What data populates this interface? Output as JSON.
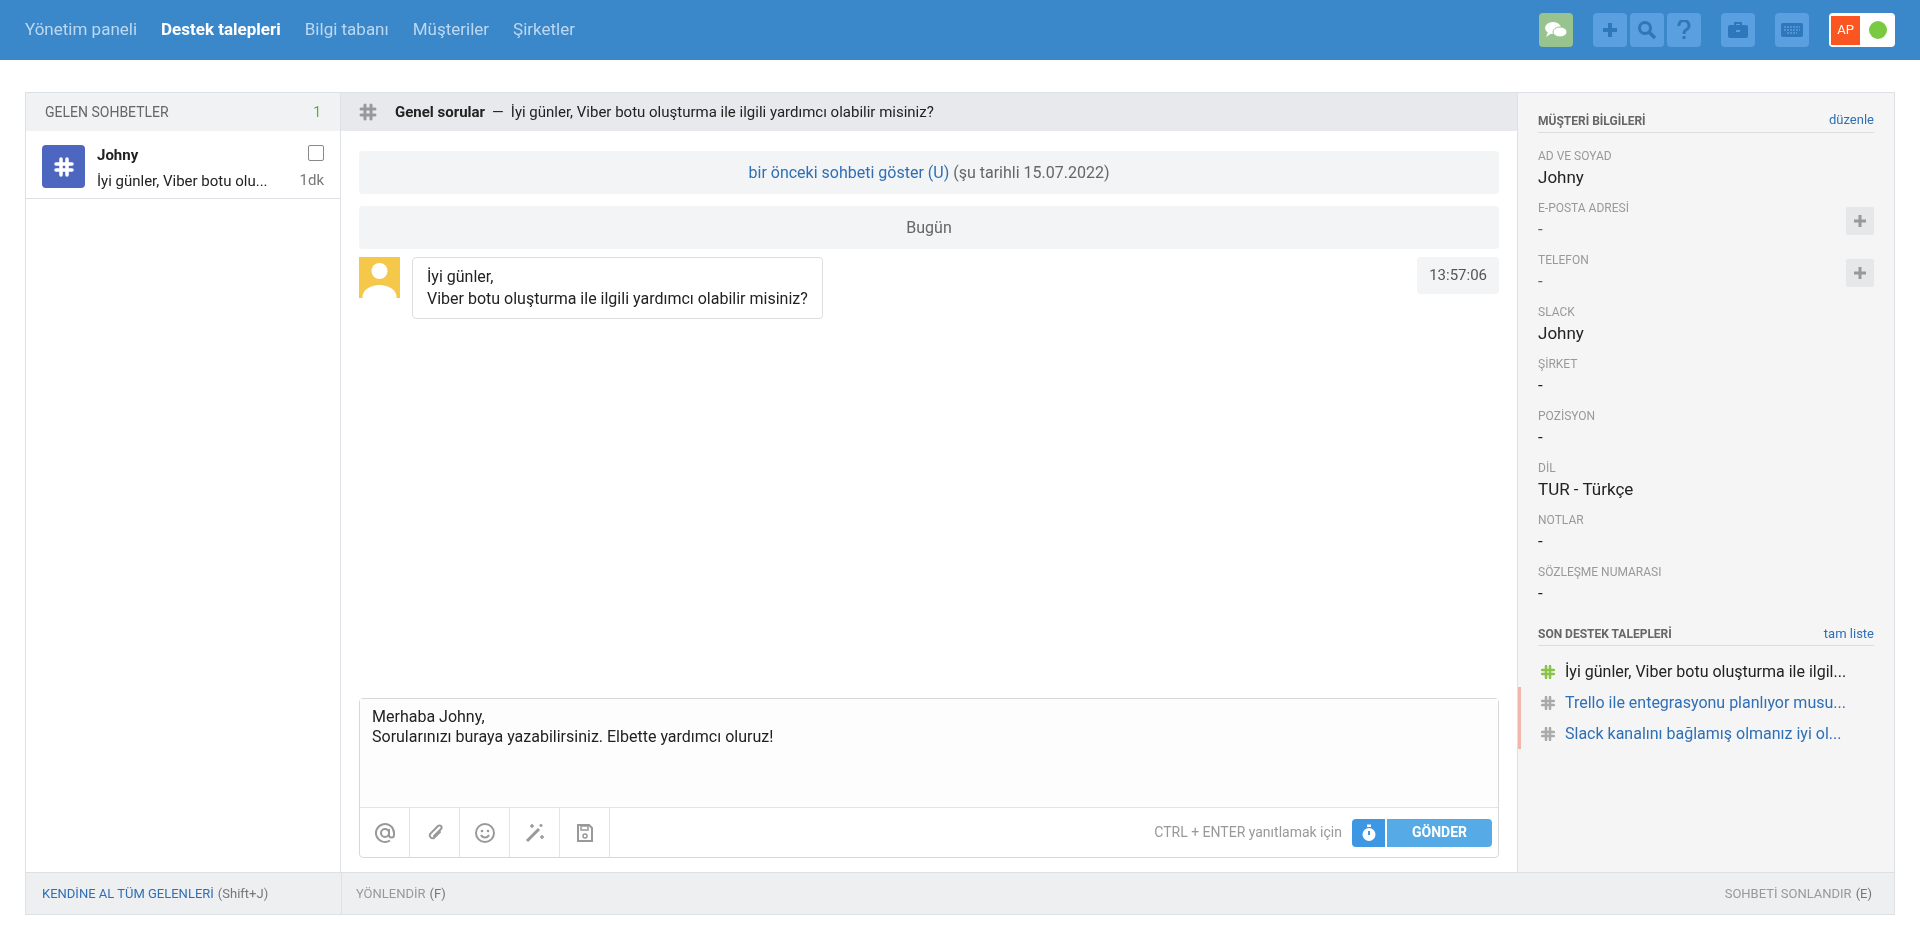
{
  "nav": [
    {
      "label": "Yönetim paneli",
      "selected": false
    },
    {
      "label": "Destek talepleri",
      "selected": true
    },
    {
      "label": "Bilgi tabanı",
      "selected": false
    },
    {
      "label": "Müşteriler",
      "selected": false
    },
    {
      "label": "Şirketler",
      "selected": false
    }
  ],
  "user": {
    "initials": "AP",
    "online": true
  },
  "incoming": {
    "title": "GELEN SOHBETLER",
    "count": "1",
    "chats": [
      {
        "name": "Johny",
        "preview": "İyi günler, Viber botu olu...",
        "time": "1dk",
        "checked": false
      }
    ]
  },
  "chat": {
    "channel": "Genel sorular",
    "separator": "—",
    "subject": "İyi günler, Viber botu oluşturma ile ilgili yardımcı olabilir misiniz?",
    "previous_link": "bir önceki sohbeti göster (U)",
    "previous_date": "(şu tarihli 15.07.2022)",
    "day": "Bugün",
    "messages": [
      {
        "lines": [
          "İyi günler,",
          "Viber botu oluşturma ile ilgili yardımcı olabilir misiniz?"
        ],
        "time": "13:57:06"
      }
    ],
    "draft": "Merhaba Johny,\nSorularınızı buraya yazabilirsiniz. Elbette yardımcı oluruz!",
    "hint": "CTRL + ENTER yanıtlamak için",
    "send": "GÖNDER"
  },
  "customer": {
    "title": "MÜŞTERİ BİLGİLERİ",
    "edit": "düzenle",
    "fields": [
      {
        "label": "AD VE SOYAD",
        "value": "Johny",
        "kind": "text"
      },
      {
        "label": "E-POSTA ADRESİ",
        "value": "-",
        "kind": "addable"
      },
      {
        "label": "TELEFON",
        "value": "-",
        "kind": "addable"
      },
      {
        "label": "SLACK",
        "value": "Johny",
        "kind": "text"
      },
      {
        "label": "ŞİRKET",
        "value": "-",
        "kind": "text"
      },
      {
        "label": "POZİSYON",
        "value": "-",
        "kind": "text"
      },
      {
        "label": "DİL",
        "value": "TUR - Türkçe",
        "kind": "text"
      },
      {
        "label": "NOTLAR",
        "value": "-",
        "kind": "text"
      },
      {
        "label": "SÖZLEŞME NUMARASI",
        "value": "-",
        "kind": "text"
      }
    ]
  },
  "recent": {
    "title": "SON DESTEK TALEPLERİ",
    "link": "tam liste",
    "items": [
      {
        "text": "İyi günler, Viber botu oluşturma ile ilgil...",
        "current": true,
        "flagged": false
      },
      {
        "text": "Trello ile entegrasyonu planlıyor musu...",
        "current": false,
        "flagged": true
      },
      {
        "text": "Slack kanalını bağlamış olmanız iyi ol...",
        "current": false,
        "flagged": true
      }
    ]
  },
  "footer": {
    "take_all": "KENDİNE AL TÜM GELENLERİ",
    "take_all_key": "(Shift+J)",
    "redirect": "YÖNLENDİR",
    "redirect_key": "(F)",
    "end": "SOHBETİ SONLANDIR",
    "end_key": "(E)"
  }
}
